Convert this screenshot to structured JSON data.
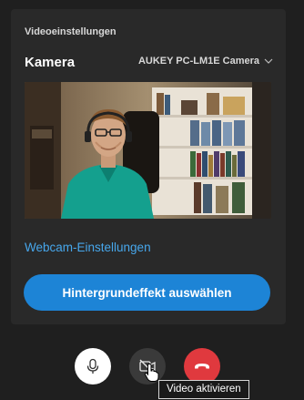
{
  "settings": {
    "section_title": "Videoeinstellungen",
    "camera_label": "Kamera",
    "camera_selected": "AUKEY PC-LM1E Camera",
    "webcam_settings_link": "Webcam-Einstellungen",
    "background_button": "Hintergrundeffekt auswählen"
  },
  "controls": {
    "mic_icon": "microphone-icon",
    "video_icon": "video-off-icon",
    "hangup_icon": "hangup-icon"
  },
  "tooltip": {
    "text": "Video aktivieren"
  },
  "colors": {
    "accent": "#1d84d6",
    "link": "#47a7ec",
    "hangup": "#e0393e",
    "panel": "#292929",
    "background": "#1f1f1f"
  }
}
